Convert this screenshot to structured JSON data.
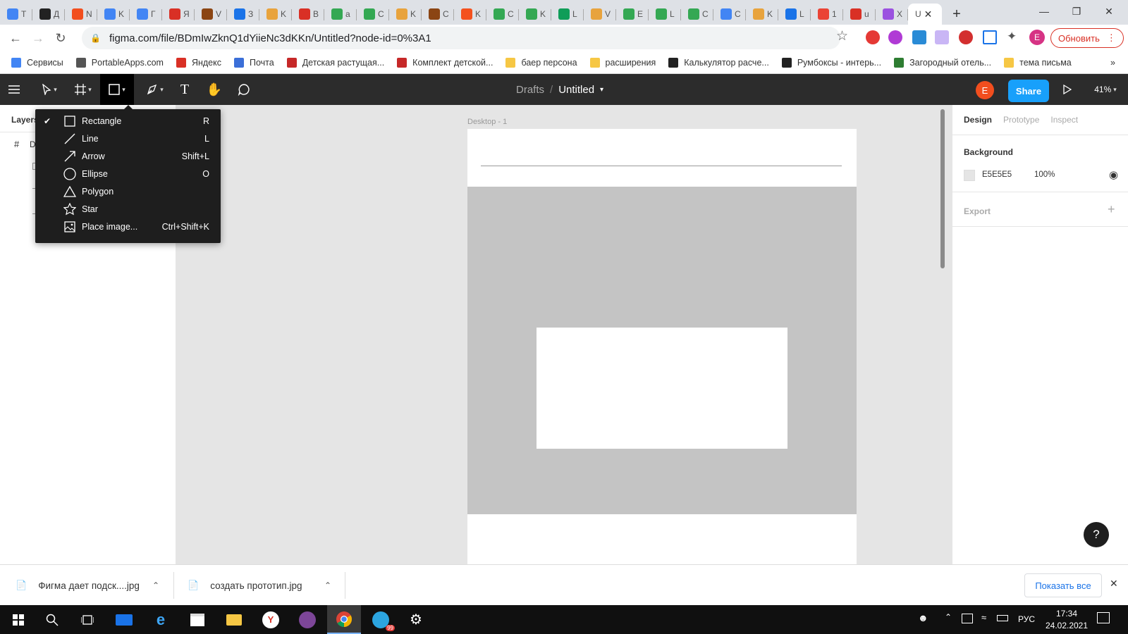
{
  "browser": {
    "tabs": [
      {
        "letter": "T",
        "color": "#4285f4"
      },
      {
        "letter": "Д",
        "color": "#222222"
      },
      {
        "letter": "N",
        "color": "#f24e1e"
      },
      {
        "letter": "K",
        "color": "#4285f4"
      },
      {
        "letter": "Г",
        "color": "#4285f4"
      },
      {
        "letter": "Я",
        "color": "#d93025"
      },
      {
        "letter": "V",
        "color": "#8b4513"
      },
      {
        "letter": "З",
        "color": "#1a73e8"
      },
      {
        "letter": "K",
        "color": "#e8a33d"
      },
      {
        "letter": "В",
        "color": "#d93025"
      },
      {
        "letter": "a",
        "color": "#34a853"
      },
      {
        "letter": "C",
        "color": "#34a853"
      },
      {
        "letter": "K",
        "color": "#e8a33d"
      },
      {
        "letter": "C",
        "color": "#8b4513"
      },
      {
        "letter": "K",
        "color": "#f4511e"
      },
      {
        "letter": "C",
        "color": "#34a853"
      },
      {
        "letter": "K",
        "color": "#34a853"
      },
      {
        "letter": "L",
        "color": "#0f9d58"
      },
      {
        "letter": "V",
        "color": "#e8a33d"
      },
      {
        "letter": "E",
        "color": "#34a853"
      },
      {
        "letter": "L",
        "color": "#34a853"
      },
      {
        "letter": "C",
        "color": "#34a853"
      },
      {
        "letter": "C",
        "color": "#4285f4"
      },
      {
        "letter": "K",
        "color": "#e8a33d"
      },
      {
        "letter": "L",
        "color": "#1a73e8"
      },
      {
        "letter": "1",
        "color": "#ea4335"
      },
      {
        "letter": "u",
        "color": "#d93025"
      },
      {
        "letter": "X",
        "color": "#9b51e0"
      }
    ],
    "active_tab": {
      "letter": "U",
      "close": "✕"
    },
    "new_tab_label": "+",
    "url": "figma.com/file/BDmIwZknQ1dYiieNc3dKKn/Untitled?node-id=0%3A1",
    "update_button": "Обновить",
    "profile_letter": "E",
    "bookmarks": [
      {
        "label": "Сервисы",
        "color": "#4285f4"
      },
      {
        "label": "PortableApps.com",
        "color": "#555555"
      },
      {
        "label": "Яндекс",
        "color": "#d93025"
      },
      {
        "label": "Почта",
        "color": "#3b6fd8"
      },
      {
        "label": "Детская растущая...",
        "color": "#c62828"
      },
      {
        "label": "Комплект детской...",
        "color": "#c62828"
      },
      {
        "label": "баер персона",
        "color": "#f6c744"
      },
      {
        "label": "расширения",
        "color": "#f6c744"
      },
      {
        "label": "Калькулятор расче...",
        "color": "#222222"
      },
      {
        "label": "Румбоксы - интерь...",
        "color": "#222222"
      },
      {
        "label": "Загородный отель...",
        "color": "#2e7d32"
      },
      {
        "label": "тема письма",
        "color": "#f6c744"
      }
    ],
    "bookmarks_more": "»"
  },
  "figma": {
    "breadcrumb_parent": "Drafts",
    "breadcrumb_sep": "/",
    "file_name": "Untitled",
    "share_label": "Share",
    "user_letter": "E",
    "zoom": "41%",
    "left_panel": {
      "tab_layers": "Layers",
      "frame_letter": "D"
    },
    "frame_label": "Desktop - 1",
    "shape_menu": [
      {
        "label": "Rectangle",
        "shortcut": "R",
        "checked": true,
        "icon": "rectangle-icon"
      },
      {
        "label": "Line",
        "shortcut": "L",
        "checked": false,
        "icon": "line-icon"
      },
      {
        "label": "Arrow",
        "shortcut": "Shift+L",
        "checked": false,
        "icon": "arrow-icon"
      },
      {
        "label": "Ellipse",
        "shortcut": "O",
        "checked": false,
        "icon": "ellipse-icon"
      },
      {
        "label": "Polygon",
        "shortcut": "",
        "checked": false,
        "icon": "polygon-icon"
      },
      {
        "label": "Star",
        "shortcut": "",
        "checked": false,
        "icon": "star-icon"
      },
      {
        "label": "Place image...",
        "shortcut": "Ctrl+Shift+K",
        "checked": false,
        "icon": "image-icon"
      }
    ],
    "right_panel": {
      "tabs": [
        "Design",
        "Prototype",
        "Inspect"
      ],
      "background_title": "Background",
      "bg_hex": "E5E5E5",
      "bg_opacity": "100%",
      "export_title": "Export",
      "export_add": "+"
    },
    "help_label": "?"
  },
  "downloads": {
    "items": [
      {
        "name": "Фигма дает подск....jpg"
      },
      {
        "name": "создать прототип.jpg"
      }
    ],
    "show_all": "Показать все",
    "close": "✕"
  },
  "taskbar": {
    "language": "РУС",
    "time": "17:34",
    "date": "24.02.2021",
    "telegram_badge": "99"
  },
  "colors": {
    "figma_dark": "#2c2c2c",
    "share_blue": "#18a0fb",
    "avatar_orange": "#f24e1e",
    "canvas_bg": "#e5e5e5"
  }
}
